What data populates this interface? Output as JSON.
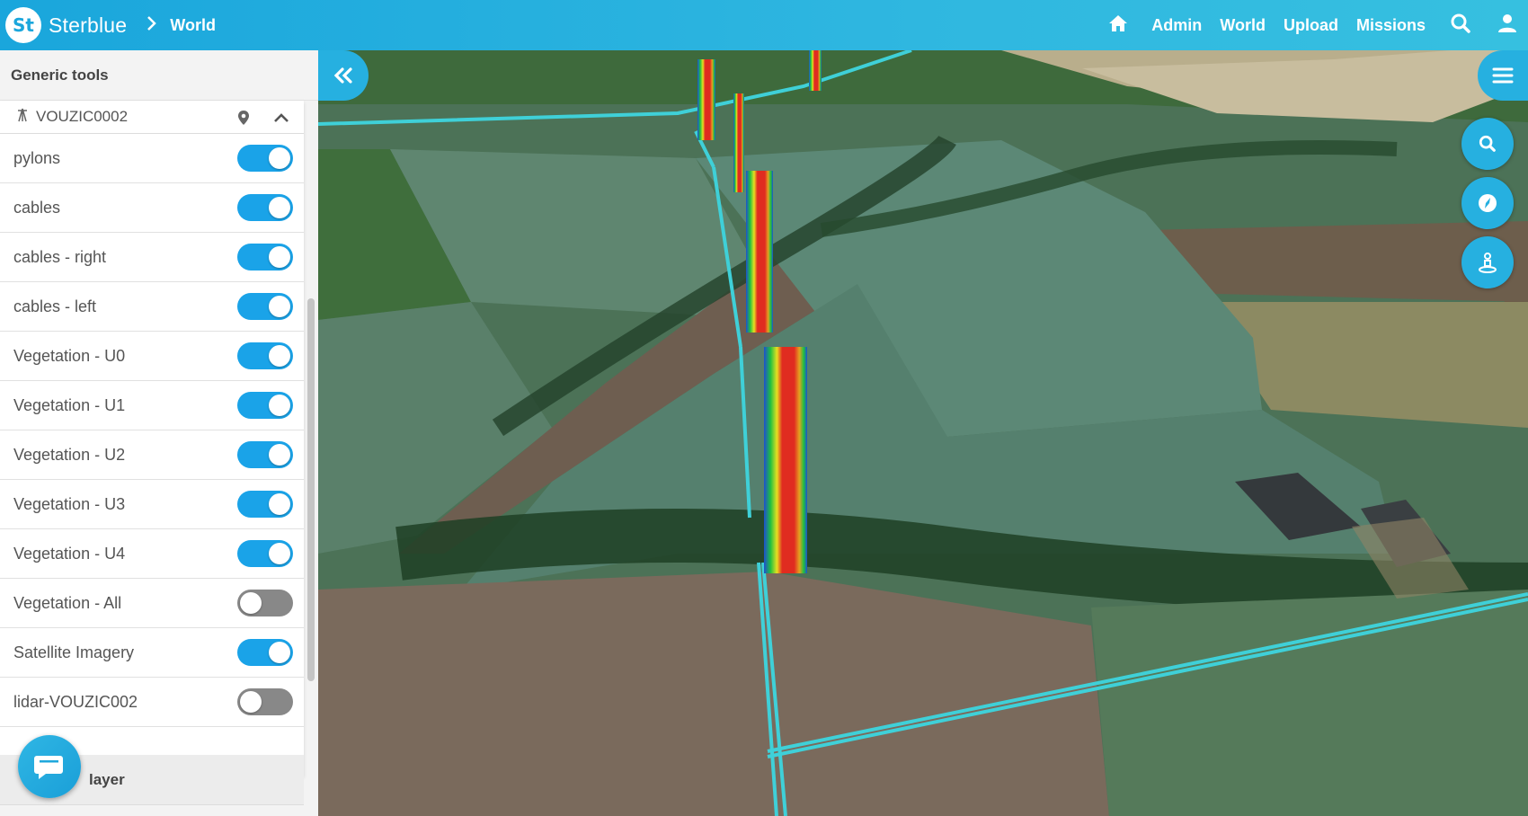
{
  "header": {
    "brand": "Sterblue",
    "logo_text": "St",
    "breadcrumb": "World",
    "nav": [
      "Admin",
      "World",
      "Upload",
      "Missions"
    ]
  },
  "panel": {
    "title": "Generic tools",
    "asset_name": "VOUZIC0002",
    "layers": [
      {
        "label": "pylons",
        "enabled": true
      },
      {
        "label": "cables",
        "enabled": true
      },
      {
        "label": "cables - right",
        "enabled": true
      },
      {
        "label": "cables - left",
        "enabled": true
      },
      {
        "label": "Vegetation - U0",
        "enabled": true
      },
      {
        "label": "Vegetation - U1",
        "enabled": true
      },
      {
        "label": "Vegetation - U2",
        "enabled": true
      },
      {
        "label": "Vegetation - U3",
        "enabled": true
      },
      {
        "label": "Vegetation - U4",
        "enabled": true
      },
      {
        "label": "Vegetation - All",
        "enabled": false
      },
      {
        "label": "Satellite Imagery",
        "enabled": true
      },
      {
        "label": "lidar-VOUZIC002",
        "enabled": false
      }
    ],
    "section2_title": "layer"
  },
  "map_controls": [
    "collapse-panel",
    "menu",
    "search",
    "compass",
    "person"
  ],
  "colors": {
    "accent": "#26b0e0",
    "toggle_on": "#1aa3e8",
    "toggle_off": "#888888",
    "cable": "#3fd0d8"
  }
}
